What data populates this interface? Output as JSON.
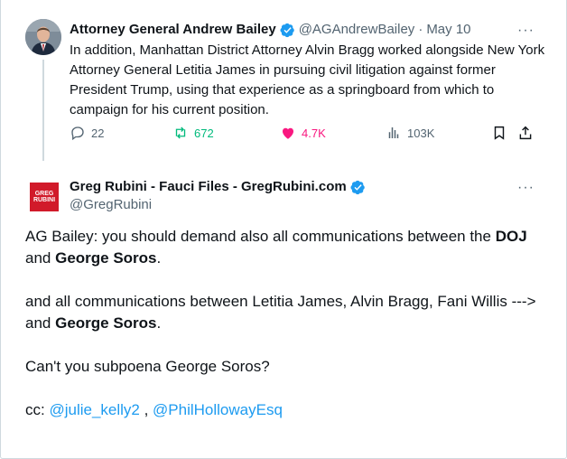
{
  "parent_tweet": {
    "author_name": "Attorney General Andrew Bailey",
    "handle": "@AGAndrewBailey",
    "separator": "·",
    "date": "May 10",
    "text": "In addition, Manhattan District Attorney Alvin Bragg worked alongside New York Attorney General Letitia James in pursuing civil litigation against former President Trump, using that experience as a springboard from which to campaign for his current position.",
    "replies": "22",
    "reposts": "672",
    "likes": "4.7K",
    "views": "103K",
    "more_label": "···",
    "icons": [
      "verified-badge-icon",
      "more-icon",
      "reply-icon",
      "repost-icon",
      "like-icon",
      "views-icon",
      "bookmark-icon",
      "share-icon"
    ]
  },
  "reply_tweet": {
    "author_name": "Greg Rubini - Fauci Files - GregRubini.com",
    "handle": "@GregRubini",
    "avatar_text_1": "GREG",
    "avatar_text_2": "RUBINI",
    "more_label": "···",
    "para1_a": "AG Bailey: you should demand also all communications between the ",
    "para1_b": "DOJ",
    "para1_c": " and ",
    "para1_d": "George Soros",
    "para1_e": ".",
    "para2_a": "and all communications between Letitia James, Alvin Bragg, Fani Willis ---> and ",
    "para2_b": "George Soros",
    "para2_c": ".",
    "para3": "Can't you subpoena George Soros?",
    "cc_label": "cc: ",
    "mention1": "@julie_kelly2",
    "cc_sep": " , ",
    "mention2": "@PhilHollowayEsq"
  },
  "colors": {
    "text": "#0f1419",
    "muted": "#536471",
    "accent": "#1d9bf0",
    "repost": "#00ba7c",
    "like": "#f91880",
    "avatar_red": "#d11a2a"
  }
}
